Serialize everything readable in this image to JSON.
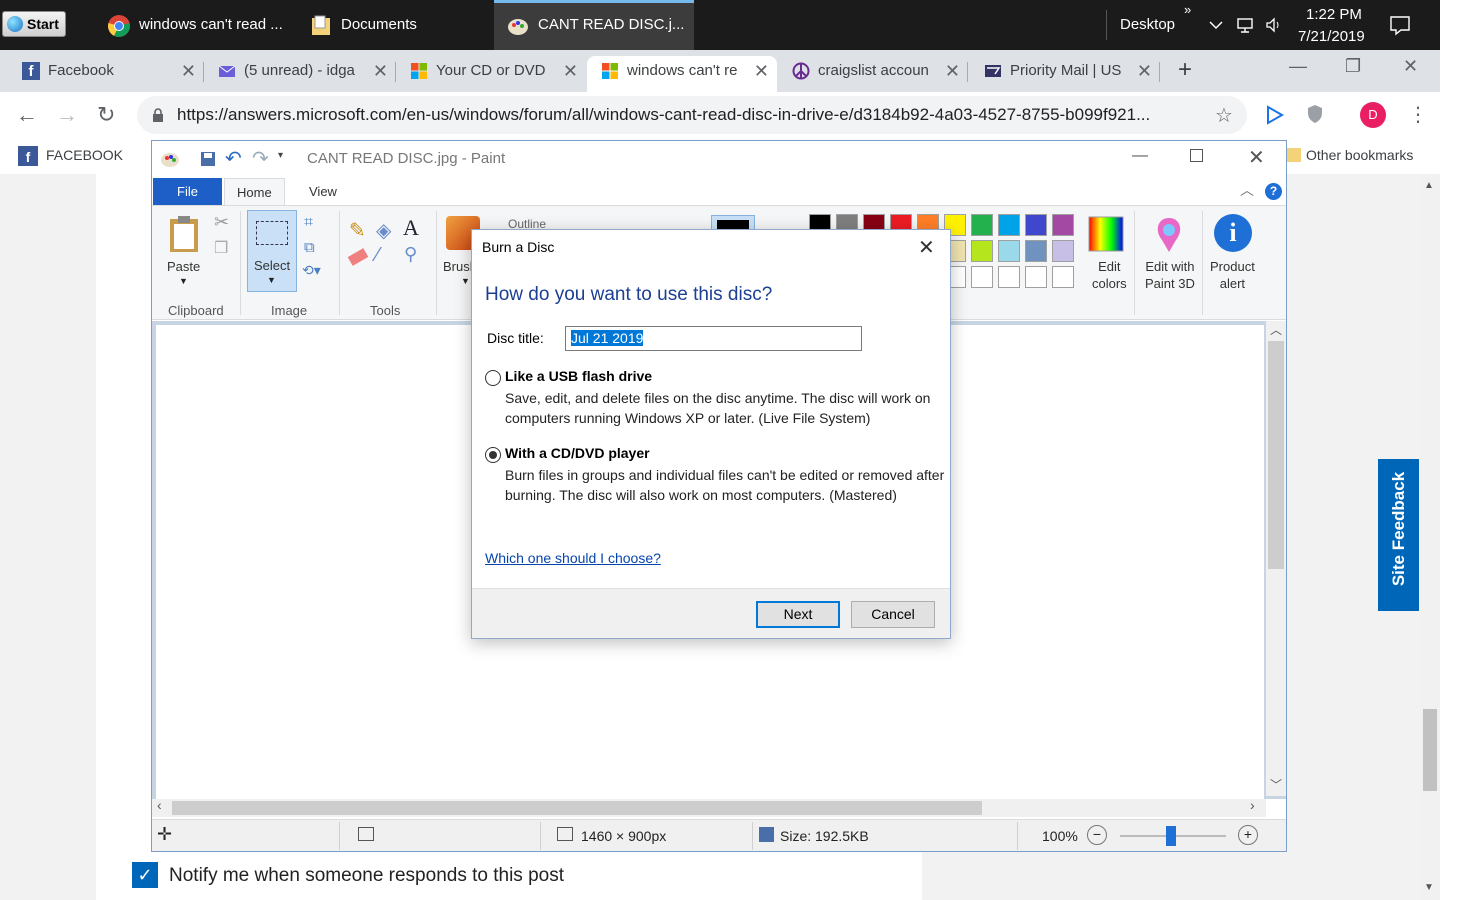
{
  "taskbar": {
    "start": "Start",
    "items": [
      {
        "label": "windows can't read ..."
      },
      {
        "label": "Documents"
      },
      {
        "label": "CANT READ DISC.j..."
      }
    ],
    "desktop": "Desktop",
    "time": "1:22 PM",
    "date": "7/21/2019"
  },
  "browser": {
    "tabs": [
      {
        "label": "Facebook"
      },
      {
        "label": "(5 unread) - idga"
      },
      {
        "label": "Your CD or DVD"
      },
      {
        "label": "windows can't re"
      },
      {
        "label": "craigslist accoun"
      },
      {
        "label": "Priority Mail | US"
      }
    ],
    "url": "https://answers.microsoft.com/en-us/windows/forum/all/windows-cant-read-disc-in-drive-e/d3184b92-4a03-4527-8755-b099f921...",
    "profile_initial": "D",
    "bookmarks": [
      {
        "label": "FACEBOOK"
      }
    ],
    "other_bookmarks": "Other bookmarks"
  },
  "page": {
    "notify_label": "Notify me when someone responds to this post",
    "site_feedback": "Site Feedback"
  },
  "paint": {
    "title": "CANT READ DISC.jpg - Paint",
    "tabs": {
      "file": "File",
      "home": "Home",
      "view": "View"
    },
    "groups": {
      "clipboard": "Clipboard",
      "image": "Image",
      "tools": "Tools"
    },
    "buttons": {
      "paste": "Paste",
      "select": "Select",
      "brush": "Brush",
      "outline": "Outline",
      "edit_colors_1": "Edit",
      "edit_colors_2": "colors",
      "paint3d_1": "Edit with",
      "paint3d_2": "Paint 3D",
      "product_1": "Product",
      "product_2": "alert"
    },
    "palette": [
      "#000000",
      "#7f7f7f",
      "#880015",
      "#ed1c24",
      "#ff7f27",
      "#fff200",
      "#22b14c",
      "#00a2e8",
      "#3f48cc",
      "#a349a4"
    ],
    "palette2": [
      "#ffffff",
      "#c3c3c3",
      "#b97a57",
      "#ffaec9",
      "#ffc90e",
      "#efe4b0",
      "#b5e61d",
      "#99d9ea",
      "#7092be",
      "#c8bfe7"
    ],
    "status": {
      "dimensions": "1460 × 900px",
      "size": "Size: 192.5KB",
      "zoom": "100%"
    }
  },
  "dialog": {
    "title": "Burn a Disc",
    "heading": "How do you want to use this disc?",
    "disc_title_label": "Disc title:",
    "disc_title_value": "Jul 21 2019",
    "option1_title": "Like a USB flash drive",
    "option1_desc": "Save, edit, and delete files on the disc anytime. The disc will work on computers running Windows XP or later. (Live File System)",
    "option2_title": "With a CD/DVD player",
    "option2_desc": "Burn files in groups and individual files can't be edited or removed after burning. The disc will also work on most computers. (Mastered)",
    "link": "Which one should I choose?",
    "next": "Next",
    "cancel": "Cancel"
  }
}
